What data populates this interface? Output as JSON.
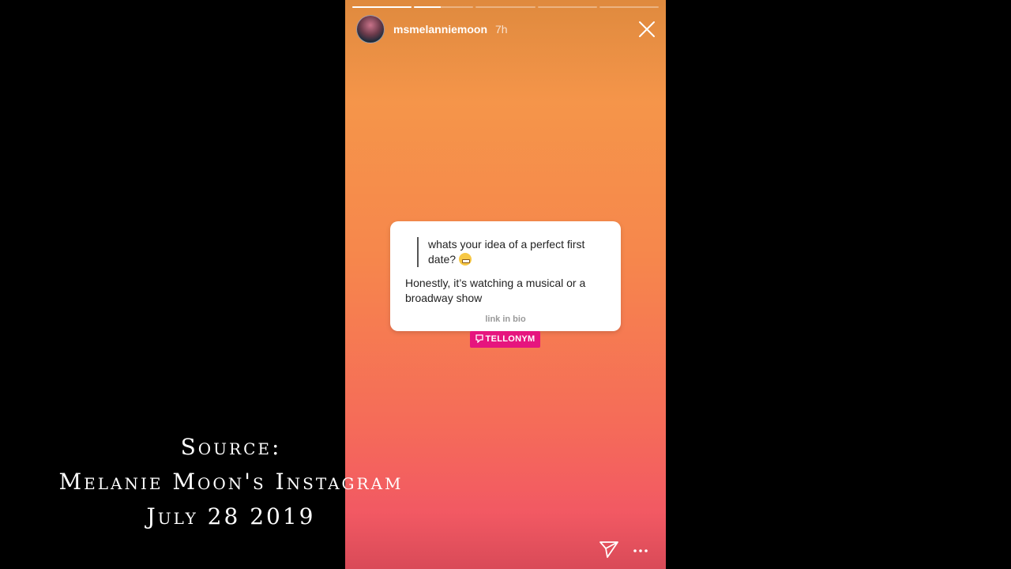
{
  "story": {
    "progress": [
      1,
      0.45,
      0,
      0,
      0
    ],
    "username": "msmelanniemoon",
    "time": "7h",
    "question": "whats your idea of a perfect first date?",
    "answer": "Honestly, it’s watching a musical or a broadway show",
    "link_text": "link in bio",
    "brand": "TELLONYM"
  },
  "overlay": {
    "line1": "Source:",
    "line2": "Melanie Moon's Instagram",
    "line3": "July 28 2019"
  },
  "icons": {
    "close": "close-icon",
    "send": "send-icon",
    "more": "more-icon",
    "emoji": "grinning-emoji-icon",
    "brand": "tellonym-icon"
  }
}
